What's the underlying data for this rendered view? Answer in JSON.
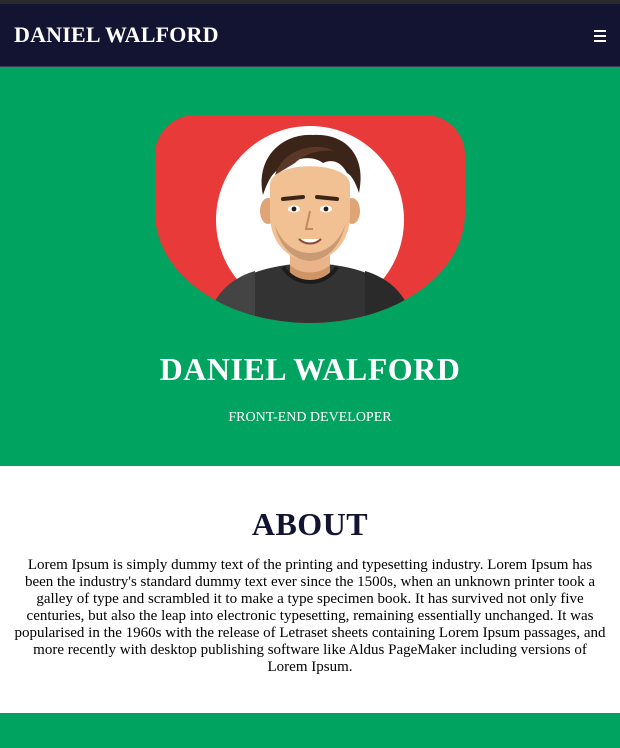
{
  "navbar": {
    "brand": "DANIEL WALFORD",
    "menu_icon": "hamburger-menu-icon"
  },
  "hero": {
    "name": "DANIEL WALFORD",
    "role": "FRONT-END DEVELOPER",
    "avatar_icon": "cartoon-portrait"
  },
  "about": {
    "heading": "ABOUT",
    "text": "Lorem Ipsum is simply dummy text of the printing and typesetting industry. Lorem Ipsum has been the industry's standard dummy text ever since the 1500s, when an unknown printer took a galley of type and scrambled it to make a type specimen book. It has survived not only five centuries, but also the leap into electronic typesetting, remaining essentially unchanged. It was popularised in the 1960s with the release of Letraset sheets containing Lorem Ipsum passages, and more recently with desktop publishing software like Aldus PageMaker including versions of Lorem Ipsum."
  },
  "colors": {
    "navbar_bg": "#131432",
    "accent_green": "#00a35f",
    "avatar_bg": "#e93a3a",
    "heading_dark": "#131432"
  }
}
